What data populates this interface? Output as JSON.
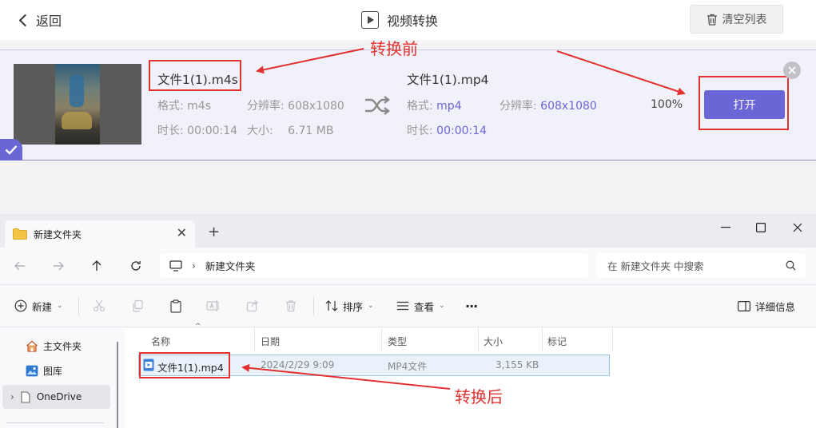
{
  "converter": {
    "back_label": "返回",
    "title": "视频转换",
    "clear_label": "清空列表",
    "source": {
      "name": "文件1(1).m4s",
      "format_label": "格式: m4s",
      "resolution_label": "分辨率: 608x1080",
      "duration_label": "时长: 00:00:14",
      "size_label": "大小:",
      "size_value": "6.71 MB"
    },
    "output": {
      "name": "文件1(1).mp4",
      "format_key": "格式:",
      "format_value": "mp4",
      "resolution_key": "分辨率:",
      "resolution_value": "608x1080",
      "duration_key": "时长:",
      "duration_value": "00:00:14"
    },
    "progress": "100%",
    "open_label": "打开",
    "accent_color": "#6a66d6"
  },
  "annotations": {
    "before": "转换前",
    "after": "转换后",
    "color": "#e23131"
  },
  "explorer": {
    "tab_title": "新建文件夹",
    "address": "新建文件夹",
    "search_placeholder": "在 新建文件夹 中搜索",
    "toolbar": {
      "new_label": "新建",
      "sort_label": "排序",
      "view_label": "查看",
      "more_label": "···",
      "details_label": "详细信息"
    },
    "nav": {
      "home": "主文件夹",
      "gallery": "图库",
      "onedrive": "OneDrive"
    },
    "columns": [
      "名称",
      "日期",
      "类型",
      "大小",
      "标记"
    ],
    "files": [
      {
        "name": "文件1(1).mp4",
        "date": "2024/2/29 9:09",
        "type": "MP4文件",
        "size": "3,155 KB"
      }
    ]
  }
}
